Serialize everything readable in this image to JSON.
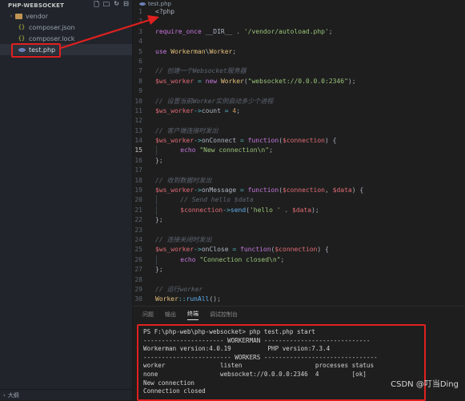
{
  "sidebar": {
    "title": "PHP-WEBSOCKET",
    "items": [
      {
        "label": "vendor",
        "type": "folder"
      },
      {
        "label": "composer.json",
        "type": "json"
      },
      {
        "label": "composer.lock",
        "type": "lock"
      },
      {
        "label": "test.php",
        "type": "php"
      }
    ],
    "footer": "大纲"
  },
  "editor": {
    "tab_label": "test.php",
    "lines": [
      {
        "n": "1",
        "html": "<span class='plain'>&lt;?php</span>"
      },
      {
        "n": "2",
        "html": ""
      },
      {
        "n": "3",
        "html": "<span class='kw'>require_once</span> <span class='plain'>__DIR__</span> <span class='plain'>.</span> <span class='str'>'/vendor/autoload.php'</span><span class='plain'>;</span>"
      },
      {
        "n": "4",
        "html": ""
      },
      {
        "n": "5",
        "html": "<span class='kw'>use</span> <span class='cls'>Workerman</span><span class='plain'>\\</span><span class='cls'>Worker</span><span class='plain'>;</span>"
      },
      {
        "n": "6",
        "html": ""
      },
      {
        "n": "7",
        "html": "<span class='cmt'>// 创建一个Websocket服务器</span>"
      },
      {
        "n": "8",
        "html": "<span class='var'>$ws_worker</span> <span class='op'>=</span> <span class='kw'>new</span> <span class='cls'>Worker</span><span class='plain'>(</span><span class='str'>\"websocket://0.0.0.0:2346\"</span><span class='plain'>);</span>"
      },
      {
        "n": "9",
        "html": ""
      },
      {
        "n": "10",
        "html": "<span class='cmt'>// 设置当前Worker实例启动多少个进程</span>"
      },
      {
        "n": "11",
        "html": "<span class='var'>$ws_worker</span><span class='op'>-&gt;</span><span class='plain'>count</span> <span class='op'>=</span> <span class='num'>4</span><span class='plain'>;</span>"
      },
      {
        "n": "12",
        "html": ""
      },
      {
        "n": "13",
        "html": "<span class='cmt'>// 客户端连接时发出</span>"
      },
      {
        "n": "14",
        "html": "<span class='var'>$ws_worker</span><span class='op'>-&gt;</span><span class='plain'>onConnect</span> <span class='op'>=</span> <span class='kw'>function</span><span class='plain'>(</span><span class='var'>$connection</span><span class='plain'>) {</span>"
      },
      {
        "n": "15",
        "html": "<span class='guide'></span><span class='plain'>    </span><span class='kw'>echo</span> <span class='str'>\"New connection\\n\"</span><span class='plain'>;</span>",
        "active": true
      },
      {
        "n": "16",
        "html": "<span class='plain'>};</span>"
      },
      {
        "n": "17",
        "html": ""
      },
      {
        "n": "18",
        "html": "<span class='cmt'>// 收到数据时发出</span>"
      },
      {
        "n": "19",
        "html": "<span class='var'>$ws_worker</span><span class='op'>-&gt;</span><span class='plain'>onMessage</span> <span class='op'>=</span> <span class='kw'>function</span><span class='plain'>(</span><span class='var'>$connection</span><span class='plain'>, </span><span class='var'>$data</span><span class='plain'>) {</span>"
      },
      {
        "n": "20",
        "html": "<span class='guide'></span><span class='plain'>    </span><span class='cmt'>// Send hello $data</span>"
      },
      {
        "n": "21",
        "html": "<span class='guide'></span><span class='plain'>    </span><span class='var'>$connection</span><span class='op'>-&gt;</span><span class='fn'>send</span><span class='plain'>(</span><span class='str'>'hello '</span> <span class='plain'>.</span> <span class='var'>$data</span><span class='plain'>);</span>"
      },
      {
        "n": "22",
        "html": "<span class='plain'>};</span>"
      },
      {
        "n": "23",
        "html": ""
      },
      {
        "n": "24",
        "html": "<span class='cmt'>// 连接关闭时发出</span>"
      },
      {
        "n": "25",
        "html": "<span class='var'>$ws_worker</span><span class='op'>-&gt;</span><span class='plain'>onClose</span> <span class='op'>=</span> <span class='kw'>function</span><span class='plain'>(</span><span class='var'>$connection</span><span class='plain'>) {</span>"
      },
      {
        "n": "26",
        "html": "<span class='guide'></span><span class='plain'>    </span><span class='kw'>echo</span> <span class='str'>\"Connection closed\\n\"</span><span class='plain'>;</span>"
      },
      {
        "n": "27",
        "html": "<span class='plain'>};</span>"
      },
      {
        "n": "28",
        "html": ""
      },
      {
        "n": "29",
        "html": "<span class='cmt'>// 运行worker</span>"
      },
      {
        "n": "30",
        "html": "<span class='cls'>Worker</span><span class='op'>::</span><span class='fn'>runAll</span><span class='plain'>();</span>"
      }
    ]
  },
  "panel": {
    "tabs": [
      "问题",
      "输出",
      "终端",
      "调试控制台"
    ],
    "active_tab": "终端",
    "terminal_lines": [
      "PS F:\\php-web\\php-websocket> php test.php start",
      "---------------------- WORKERMAN -----------------------------",
      "Workerman version:4.0.19          PHP version:7.3.4",
      "------------------------ WORKERS -------------------------------",
      "worker               listen                    processes status",
      "none                 websocket://0.0.0.0:2346  4         [ok]",
      "New connection",
      "Connection closed"
    ]
  },
  "watermark": "CSDN @叮当Ding",
  "colors": {
    "highlight": "#e02020",
    "sidebar_bg": "#21252b",
    "editor_bg": "#1e1e1e"
  }
}
